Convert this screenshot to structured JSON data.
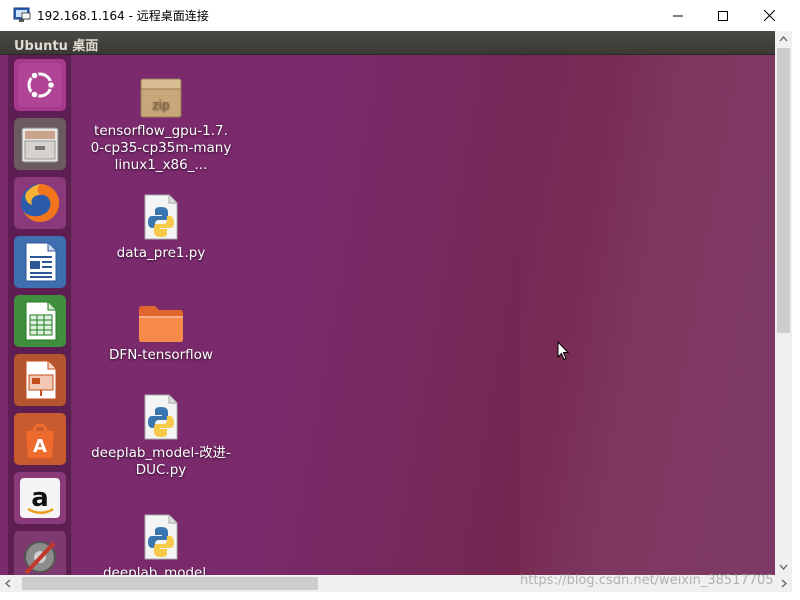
{
  "window": {
    "title": "192.168.1.164 - 远程桌面连接",
    "app_icon": "remote-desktop-icon",
    "buttons": [
      "minimize",
      "maximize",
      "close"
    ]
  },
  "panel": {
    "title": "Ubuntu 桌面"
  },
  "launcher": {
    "items": [
      {
        "name": "ubuntu-dash",
        "icon": "ubuntu-logo-icon"
      },
      {
        "name": "files",
        "icon": "file-cabinet-icon"
      },
      {
        "name": "firefox",
        "icon": "firefox-icon"
      },
      {
        "name": "libreoffice-writer",
        "icon": "writer-document-icon"
      },
      {
        "name": "libreoffice-calc",
        "icon": "calc-spreadsheet-icon"
      },
      {
        "name": "libreoffice-impress",
        "icon": "impress-presentation-icon"
      },
      {
        "name": "ubuntu-software",
        "icon": "software-bag-icon"
      },
      {
        "name": "amazon",
        "icon": "amazon-icon"
      },
      {
        "name": "system-settings",
        "icon": "settings-tools-icon"
      }
    ]
  },
  "desktop": {
    "items": [
      {
        "label": "tensorflow_gpu-1.7.0-cp35-cp35m-manylinux1_x86_...",
        "icon": "zip-archive-icon",
        "icon_text": "zip"
      },
      {
        "label": "data_pre1.py",
        "icon": "python-file-icon"
      },
      {
        "label": "DFN-tensorflow",
        "icon": "folder-icon"
      },
      {
        "label": "deeplab_model-改进-DUC.py",
        "icon": "python-file-icon"
      },
      {
        "label": "deeplab_model...",
        "icon": "python-file-icon"
      }
    ]
  },
  "watermark": "https://blog.csdn.net/weixin_38517705",
  "colors": {
    "desktop_bg": "#7a2a6a",
    "panel_bg": "#3f3e39",
    "accent_orange": "#e95420"
  }
}
